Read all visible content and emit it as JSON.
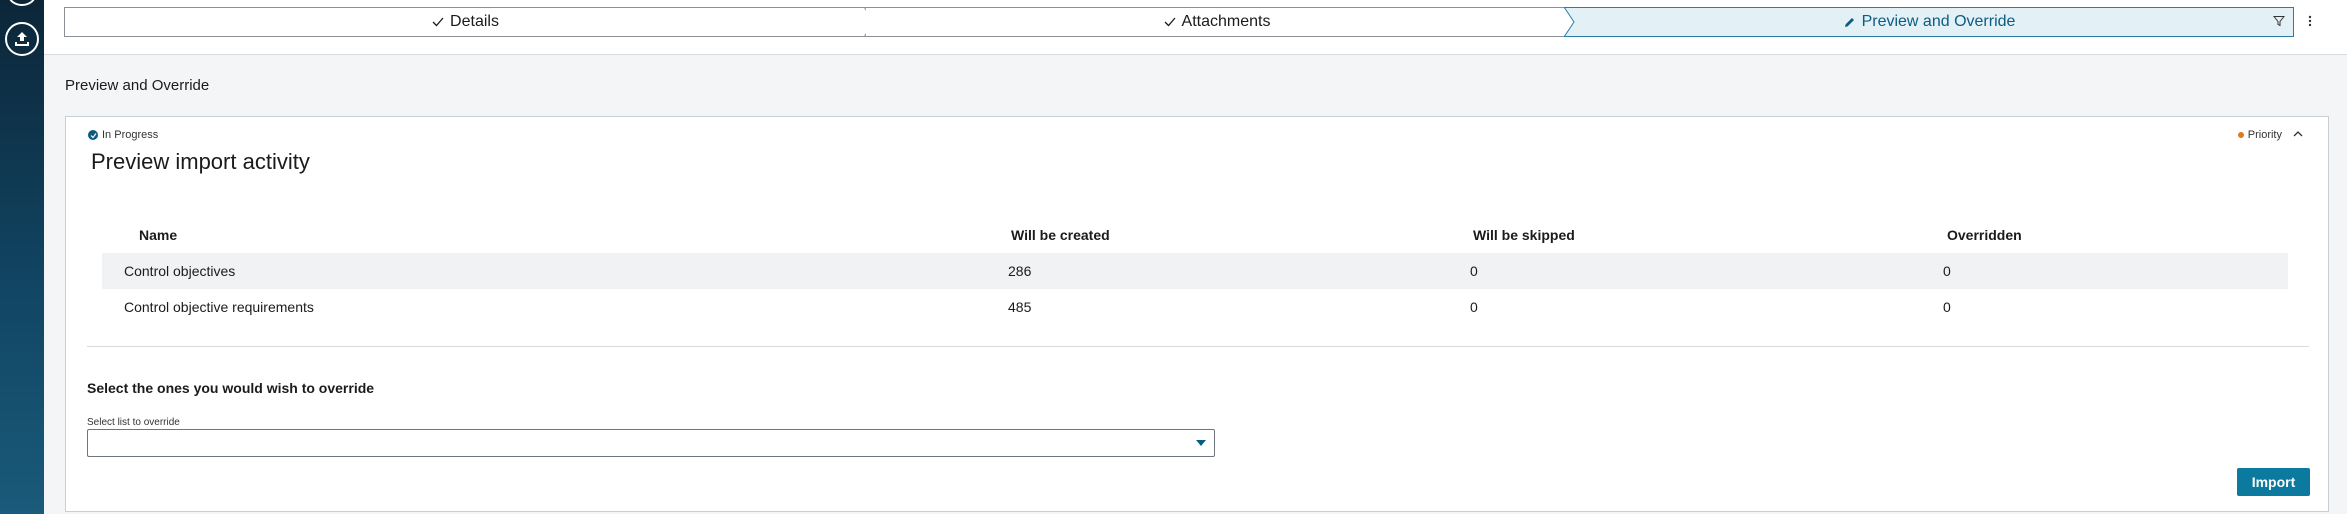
{
  "stepper": {
    "steps": [
      {
        "label": "Details",
        "state": "complete",
        "icon": "check-icon"
      },
      {
        "label": "Attachments",
        "state": "complete",
        "icon": "check-icon"
      },
      {
        "label": "Preview and Override",
        "state": "active",
        "icon": "pencil-icon"
      }
    ]
  },
  "toolbar": {
    "filter_icon": "filter-icon",
    "more_icon": "more-vertical-icon"
  },
  "page": {
    "heading": "Preview and Override"
  },
  "card": {
    "status": "In Progress",
    "priority": "Priority",
    "title": "Preview import activity",
    "table": {
      "headers": [
        "Name",
        "Will be created",
        "Will be skipped",
        "Overridden"
      ],
      "rows": [
        {
          "name": "Control objectives",
          "created": "286",
          "skipped": "0",
          "overridden": "0"
        },
        {
          "name": "Control objective requirements",
          "created": "485",
          "skipped": "0",
          "overridden": "0"
        }
      ]
    },
    "override": {
      "title": "Select the ones you would wish to override",
      "select_label": "Select list to override",
      "select_value": ""
    },
    "import_label": "Import"
  },
  "colors": {
    "accent": "#0b7a9e",
    "active_step_bg": "#e3f1f7",
    "priority_dot": "#e07a1f",
    "rail": "#0c2638"
  }
}
